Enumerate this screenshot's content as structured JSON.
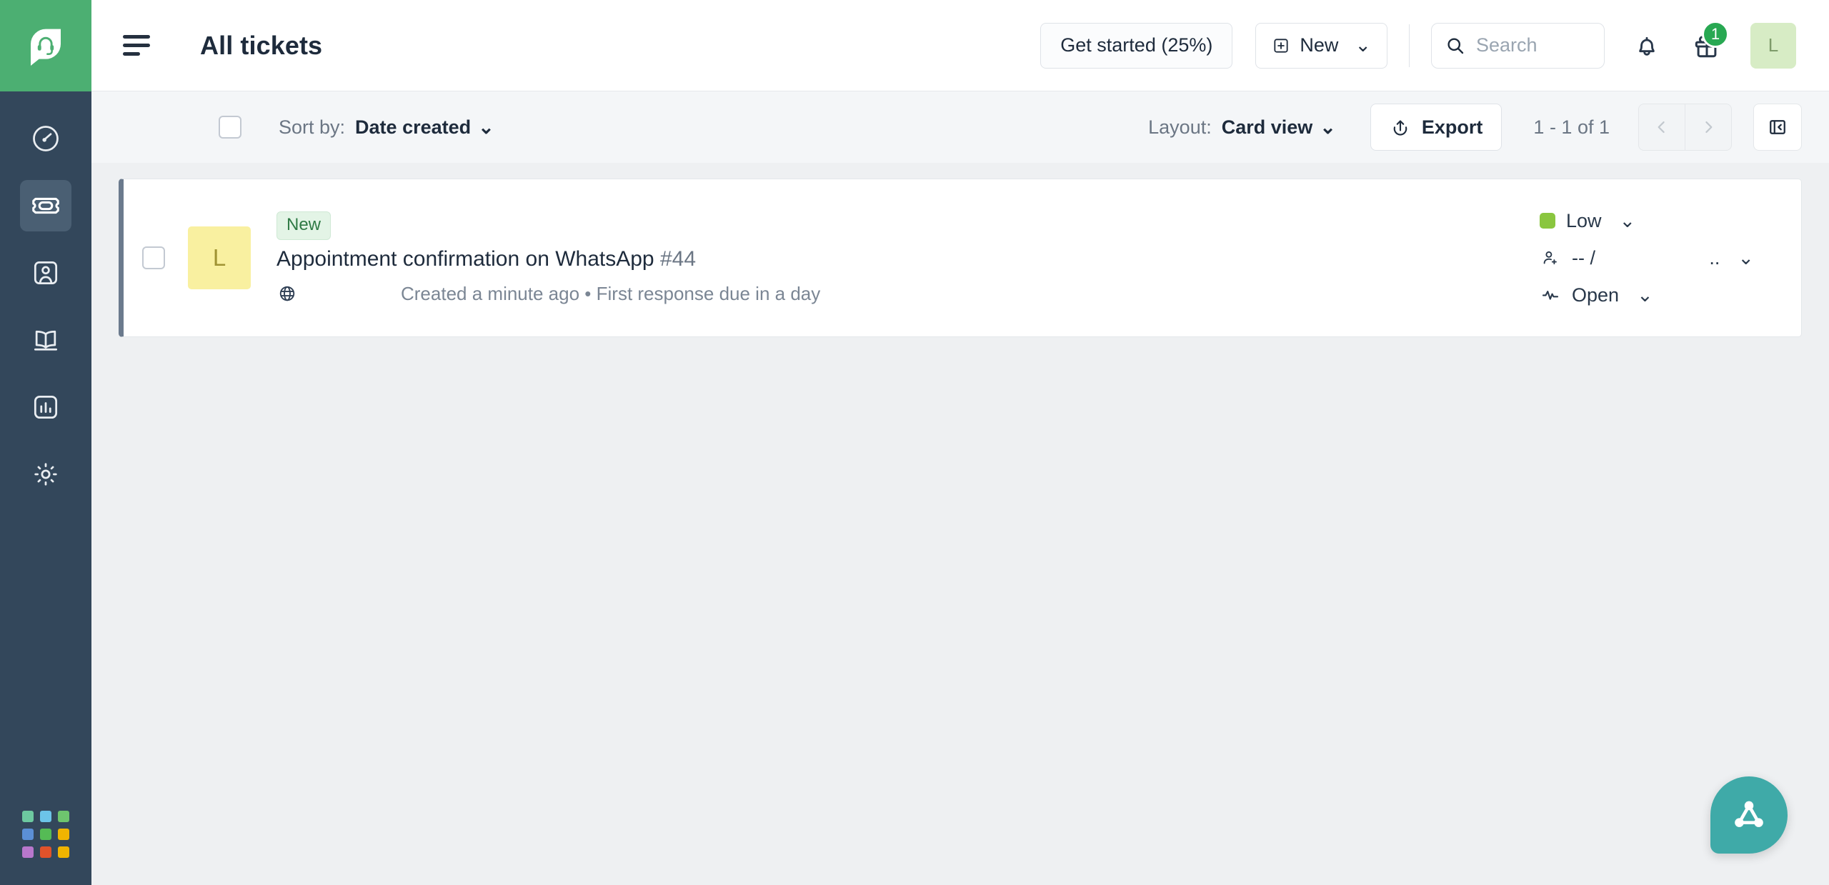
{
  "brand": {
    "logo_icon": "headset-logo-icon",
    "accent": "#4caf72",
    "rail_bg": "#33475b"
  },
  "sidebar": {
    "items": [
      {
        "icon": "dashboard-icon",
        "name": "dashboard",
        "active": false
      },
      {
        "icon": "ticket-icon",
        "name": "tickets",
        "active": true
      },
      {
        "icon": "contacts-icon",
        "name": "contacts",
        "active": false
      },
      {
        "icon": "knowledge-base-icon",
        "name": "solutions",
        "active": false
      },
      {
        "icon": "reports-icon",
        "name": "analytics",
        "active": false
      },
      {
        "icon": "gear-icon",
        "name": "admin",
        "active": false
      }
    ],
    "apps_icon": "apps-grid-icon",
    "apps_colors": [
      "#6dc9a0",
      "#6cc4e8",
      "#6ec46e",
      "#5b8fd6",
      "#55bb55",
      "#f0b400",
      "#b877cc",
      "#e0522a",
      "#f0b400"
    ]
  },
  "header": {
    "menu_icon": "hamburger-menu-icon",
    "title": "All tickets",
    "get_started_label": "Get started (25%)",
    "new_label": "New",
    "new_icon": "plus-square-icon",
    "new_caret": "⌄",
    "search": {
      "icon": "search-icon",
      "placeholder": "Search",
      "value": ""
    },
    "notifications_icon": "bell-icon",
    "gifts_icon": "gift-icon",
    "gifts_badge": "1",
    "avatar": {
      "icon": "avatar",
      "initial": "L",
      "bg": "#d7ecc5"
    }
  },
  "toolbar": {
    "select_all_name": "select-all-checkbox",
    "sort_label": "Sort by:",
    "sort_value": "Date created",
    "layout_label": "Layout:",
    "layout_value": "Card view",
    "export_label": "Export",
    "export_icon": "export-icon",
    "pagination_text": "1 - 1 of 1",
    "prev_icon": "chevron-left-icon",
    "next_icon": "chevron-right-icon",
    "collapse_icon": "collapse-panel-icon",
    "caret": "⌄"
  },
  "tickets": [
    {
      "status_badge": "New",
      "avatar_initial": "L",
      "avatar_bg": "#f9f0a0",
      "subject": "Appointment confirmation on WhatsApp",
      "number": "#44",
      "channel_icon": "globe-icon",
      "created": "Created a minute ago",
      "separator": "•",
      "sla": "First response due in a day",
      "priority": "Low",
      "priority_color": "#8ac63f",
      "agent_icon": "add-agent-icon",
      "agent": "-- /",
      "group": "..",
      "state_icon": "activity-icon",
      "state": "Open",
      "caret": "⌄"
    }
  ],
  "fab": {
    "icon": "freddy-ai-icon",
    "color": "#3faaa8"
  }
}
